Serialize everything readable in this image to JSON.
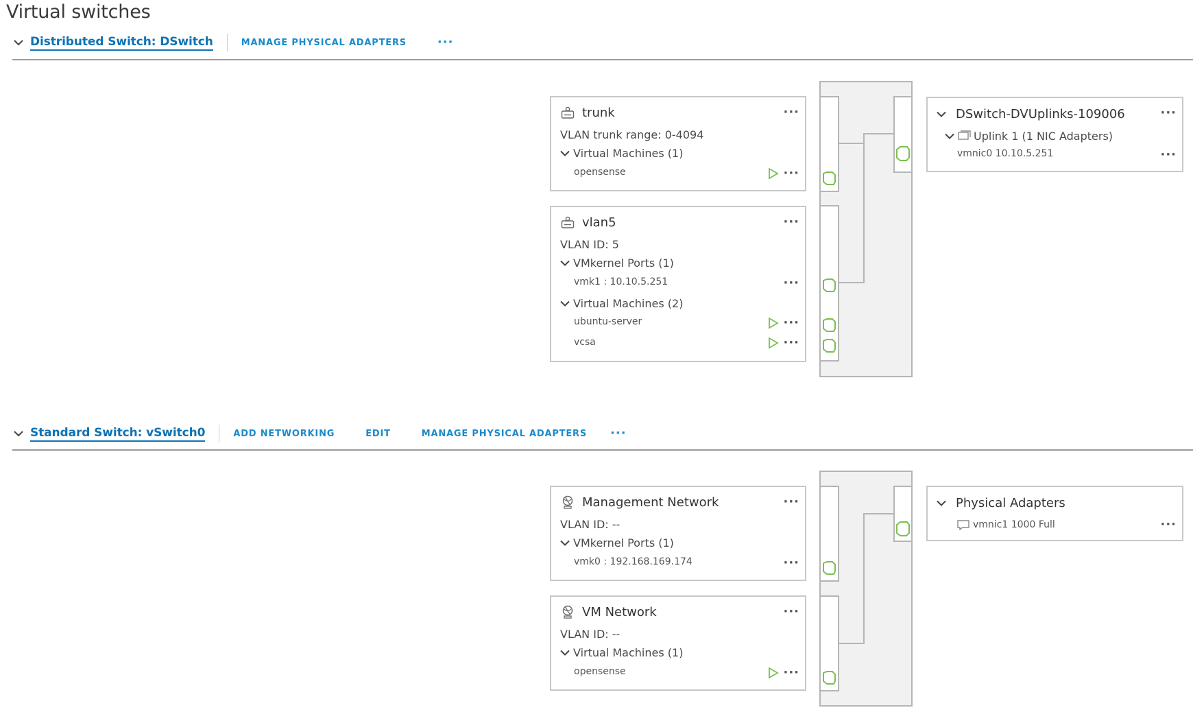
{
  "page": {
    "title": "Virtual switches"
  },
  "distributed_switch": {
    "link_label": "Distributed Switch: DSwitch",
    "actions": [
      "MANAGE PHYSICAL ADAPTERS"
    ],
    "more_label": "···",
    "port_groups": [
      {
        "name": "trunk",
        "icon": "distributed-portgroup-icon",
        "vlan": "VLAN trunk range: 0-4094",
        "vm_group": {
          "label": "Virtual Machines (1)",
          "items": [
            "opensense"
          ]
        }
      },
      {
        "name": "vlan5",
        "icon": "distributed-portgroup-icon",
        "vlan": "VLAN ID: 5",
        "vmk_group": {
          "label": "VMkernel Ports (1)",
          "items": [
            "vmk1 : 10.10.5.251"
          ]
        },
        "vm_group": {
          "label": "Virtual Machines (2)",
          "items": [
            "ubuntu-server",
            "vcsa"
          ]
        }
      }
    ],
    "uplinks": {
      "name": "DSwitch-DVUplinks-109006",
      "uplink_label": "Uplink 1 (1 NIC Adapters)",
      "nic": "vmnic0 10.10.5.251"
    }
  },
  "standard_switch": {
    "link_label": "Standard Switch: vSwitch0",
    "actions": [
      "ADD NETWORKING",
      "EDIT",
      "MANAGE PHYSICAL ADAPTERS"
    ],
    "more_label": "···",
    "port_groups": [
      {
        "name": "Management Network",
        "icon": "standard-portgroup-icon",
        "vlan": "VLAN ID: --",
        "vmk_group": {
          "label": "VMkernel Ports (1)",
          "items": [
            "vmk0 : 192.168.169.174"
          ]
        }
      },
      {
        "name": "VM Network",
        "icon": "standard-portgroup-icon",
        "vlan": "VLAN ID: --",
        "vm_group": {
          "label": "Virtual Machines (1)",
          "items": [
            "opensense"
          ]
        }
      }
    ],
    "physical_adapters": {
      "title": "Physical Adapters",
      "nic": "vmnic1 1000 Full"
    }
  },
  "ellipsis": "···",
  "colors": {
    "link": "#0f72b4",
    "action": "#1b8bca",
    "port_green": "#7cbf4e",
    "border": "#c8c8c8",
    "connector_bg": "#f1f1f1"
  }
}
